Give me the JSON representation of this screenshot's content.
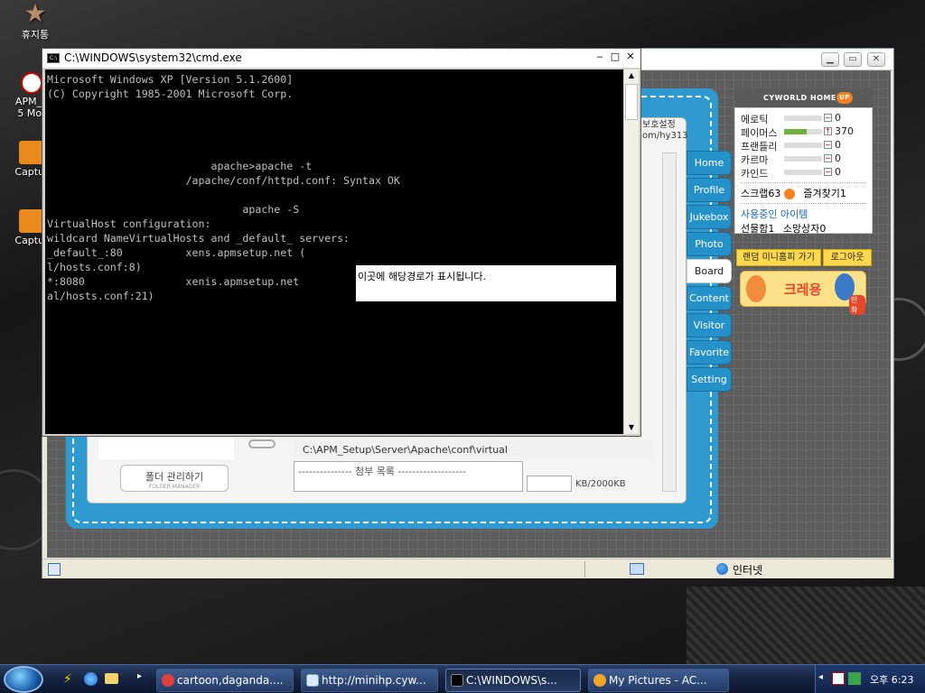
{
  "desktop": {
    "icons": [
      {
        "label": "휴지통",
        "icon": "recycle-bin-icon"
      },
      {
        "label": "APM_S\n5 Mor",
        "icon": "apm-icon"
      },
      {
        "label": "Captur",
        "icon": "jpg-file-icon"
      },
      {
        "label": "Captur",
        "icon": "jpg-file-icon"
      }
    ]
  },
  "cmd": {
    "title": "C:\\WINDOWS\\system32\\cmd.exe",
    "lines": [
      "Microsoft Windows XP [Version 5.1.2600]",
      "(C) Copyright 1985-2001 Microsoft Corp.",
      "apache>apache -t",
      "/apache/conf/httpd.conf: Syntax OK",
      "apache -S",
      "VirtualHost configuration:",
      "wildcard NameVirtualHosts and _default_ servers:",
      "_default_:80          xens.apmsetup.net (",
      "l/hosts.conf:8)",
      "*:8080                xenis.apmsetup.net",
      "al/hosts.conf:21)"
    ],
    "popup_text": "이곳에 해당경로가 표시됩니다."
  },
  "ie": {
    "status_text": "인터넷",
    "colors": {
      "accent": "#2f9ad0"
    }
  },
  "cyworld": {
    "nav": [
      "Home",
      "Profile",
      "Jukebox",
      "Photo",
      "Board",
      "Content",
      "Visitor",
      "Favorite",
      "Setting"
    ],
    "active_tab": "Board",
    "header_fragments": [
      "보호설정",
      "om/hy313"
    ],
    "cyworld_home": "CYWORLD HOME",
    "up_badge": "UP",
    "stats": [
      {
        "label": "에로틱",
        "value": "0",
        "fill": 0
      },
      {
        "label": "페이머스",
        "value": "370",
        "fill": 0.6
      },
      {
        "label": "프랜들리",
        "value": "0",
        "fill": 0
      },
      {
        "label": "카르마",
        "value": "0",
        "fill": 0
      },
      {
        "label": "카인드",
        "value": "0",
        "fill": 0
      }
    ],
    "scrap": "스크랩63",
    "favorites": "즐겨찾기1",
    "using_items": "사용중인 아이템",
    "gifts": "선물함1",
    "wish": "소망상자0",
    "random_btn": "랜덤 미니홈피 가기",
    "logout_btn": "로그아웃",
    "banner_text": "크레용",
    "banner_sub": "만화",
    "folder_btn": "폴더 관리하기",
    "folder_sub": "FOLDER MANAGER",
    "path_text": "C:\\APM_Setup\\Server\\Apache\\conf\\virtual",
    "attach_label": "--------------- 첨부 목록 -------------------",
    "kb_text": "KB/2000KB"
  },
  "taskbar": {
    "tasks": [
      {
        "label": "cartoon,daganda....",
        "icon": "cartoon-app-icon"
      },
      {
        "label": "http://minihp.cyw...",
        "icon": "ie-icon"
      },
      {
        "label": "C:\\WINDOWS\\s...",
        "icon": "cmd-icon"
      },
      {
        "label": "My Pictures - AC...",
        "icon": "acdsee-icon"
      }
    ],
    "clock": "오후 6:23"
  }
}
